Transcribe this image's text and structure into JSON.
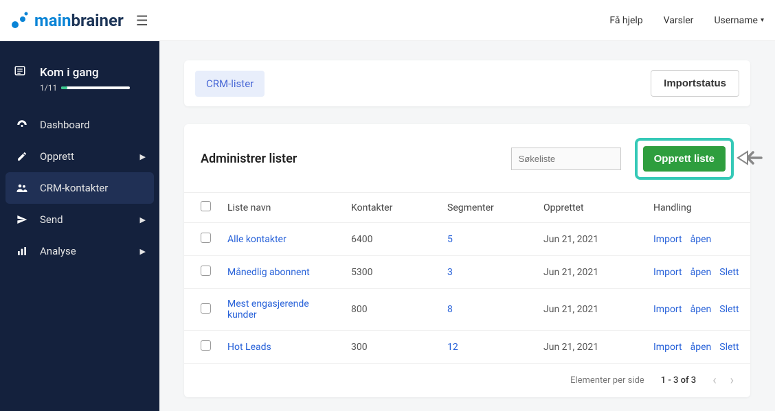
{
  "topbar": {
    "brand_main": "main",
    "brand_sub": "brainer",
    "help": "Få hjelp",
    "alerts": "Varsler",
    "username": "Username"
  },
  "sidebar": {
    "start": {
      "label": "Kom i gang",
      "progress": "1/11"
    },
    "items": [
      {
        "icon": "dashboard",
        "label": "Dashboard",
        "expandable": false
      },
      {
        "icon": "pencil",
        "label": "Opprett",
        "expandable": true
      },
      {
        "icon": "users",
        "label": "CRM-kontakter",
        "expandable": false,
        "active": true
      },
      {
        "icon": "send",
        "label": "Send",
        "expandable": true
      },
      {
        "icon": "chart",
        "label": "Analyse",
        "expandable": true
      }
    ]
  },
  "tabs": {
    "crm_lists": "CRM-lister",
    "import_status": "Importstatus"
  },
  "lists": {
    "title": "Administrer lister",
    "search_placeholder": "Søkeliste",
    "create_btn": "Opprett liste",
    "columns": {
      "name": "Liste navn",
      "contacts": "Kontakter",
      "segments": "Segmenter",
      "created": "Opprettet",
      "actions": "Handling"
    },
    "rows": [
      {
        "name": "Alle kontakter",
        "contacts": "6400",
        "segments": "5",
        "created": "Jun 21, 2021",
        "actions": [
          "Import",
          "åpen"
        ]
      },
      {
        "name": "Månedlig abonnent",
        "contacts": "5300",
        "segments": "3",
        "created": "Jun 21, 2021",
        "actions": [
          "Import",
          "åpen",
          "Slett"
        ]
      },
      {
        "name": "Mest engasjerende kunder",
        "contacts": "800",
        "segments": "8",
        "created": "Jun 21, 2021",
        "actions": [
          "Import",
          "åpen",
          "Slett"
        ]
      },
      {
        "name": "Hot Leads",
        "contacts": "300",
        "segments": "12",
        "created": "Jun 21, 2021",
        "actions": [
          "Import",
          "åpen",
          "Slett"
        ]
      }
    ],
    "footer": {
      "per_page": "Elementer per side",
      "range": "1 - 3 of 3"
    }
  }
}
